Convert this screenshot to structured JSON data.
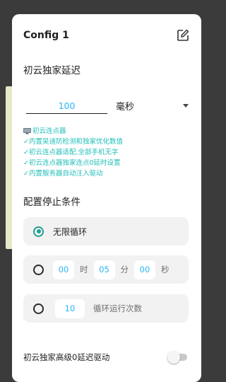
{
  "dialog": {
    "title": "Config 1",
    "edit_icon": "edit-square-icon"
  },
  "delay": {
    "title": "初云独家延迟",
    "value": "100",
    "unit": "毫秒"
  },
  "features": [
    "初云连点器",
    "✓内置吴迪防检测和独家优化数值",
    "✓初云连点器适配,全部手机无字",
    "✓初云连点器独家连点0延时设置",
    "✓内置服务器自动注入驱动"
  ],
  "stop_conditions": {
    "title": "配置停止条件",
    "infinite_label": "无限循环",
    "timer": {
      "hours": "00",
      "hours_unit": "时",
      "minutes": "05",
      "minutes_unit": "分",
      "seconds": "00",
      "seconds_unit": "秒"
    },
    "count": {
      "value": "10",
      "label": "循环运行次数"
    },
    "selected": "infinite"
  },
  "driver": {
    "label": "初云独家高级0延迟驱动",
    "enabled": false
  },
  "colors": {
    "accent": "#21a094",
    "value_text": "#29b6f6",
    "feature_text": "#1fbfb8"
  }
}
